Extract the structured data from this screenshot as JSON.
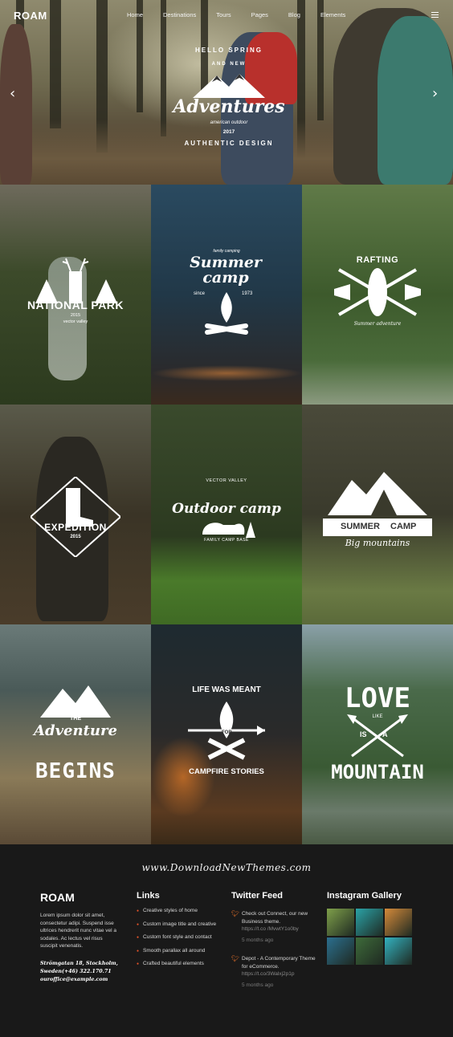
{
  "nav": {
    "logo": "ROAM",
    "items": [
      "Home",
      "Destinations",
      "Tours",
      "Pages",
      "Blog",
      "Elements"
    ]
  },
  "hero": {
    "badge": {
      "top": "HELLO SPRING",
      "and_new": "AND NEW",
      "title": "Adventures",
      "subtitle": "american outdoor",
      "year": "2017",
      "bottom": "AUTHENTIC DESIGN"
    },
    "prev_icon": "chevron-left-icon",
    "next_icon": "chevron-right-icon"
  },
  "tiles": [
    {
      "label": "NATIONAL PARK",
      "sub": "vector valley",
      "year": "2015"
    },
    {
      "label": "Summer camp",
      "top": "family camping",
      "since": "since",
      "year": "1973"
    },
    {
      "label": "RAFTING",
      "sub": "Summer adventure"
    },
    {
      "label": "EXPEDITION",
      "year": "2015"
    },
    {
      "label": "Outdoor camp",
      "top": "VECTOR VALLEY",
      "sub": "FAMILY CAMP BASE"
    },
    {
      "label": "SUMMER",
      "label2": "CAMP",
      "sub": "Big mountains"
    },
    {
      "label": "Adventure",
      "the": "THE",
      "bottom": "BEGINS"
    },
    {
      "label": "LIFE WAS MEANT",
      "for": "FOR",
      "bottom": "CAMPFIRE STORIES"
    },
    {
      "label": "LOVE",
      "like": "LIKE",
      "is": "IS",
      "a": "A",
      "bottom": "MOUNTAIN"
    }
  ],
  "footer": {
    "site": "www.DownloadNewThemes.com",
    "about": {
      "title": "ROAM",
      "text": "Lorem ipsum dolor sit amet, consectetur adipi. Suspend isse ultrices hendrerit nunc vitae vel a sodales. Ac lectus vel risus suscipit venenatis.",
      "address1": "Strömgatan 18, Stockholm,",
      "address2": "Sweden(+46) 322.170.71",
      "email": "ouroffice@example.com"
    },
    "links": {
      "title": "Links",
      "items": [
        "Creative styles of home",
        "Custom image title and creative",
        "Custom font style and contact",
        "Smooth parallax all around",
        "Crafted beautiful elements"
      ]
    },
    "twitter": {
      "title": "Twitter Feed",
      "tweets": [
        {
          "text": "Check out Connect, our new Business theme.",
          "link": "https://t.co /MvwtY1o0by",
          "ago": "5 months ago"
        },
        {
          "text": "Depot - A Contemporary Theme for eCommerce.",
          "link": "https://t.co/3Walxj2p1p",
          "ago": "5 months ago"
        }
      ]
    },
    "instagram": {
      "title": "Instagram Gallery",
      "colors": [
        "#7fa04a",
        "#2aa3a8",
        "#d58a3a",
        "#2b6f8f",
        "#3e6b3a",
        "#33b2c0"
      ]
    }
  }
}
